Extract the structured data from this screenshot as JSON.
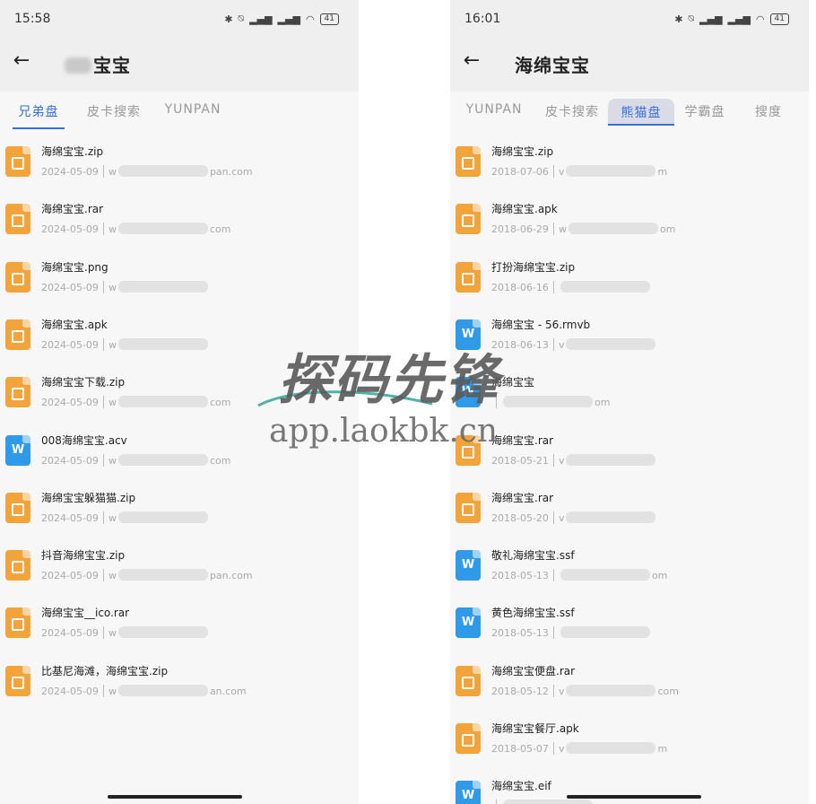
{
  "left": {
    "time": "15:58",
    "battery": "41",
    "title": "宝宝",
    "tabs": [
      "兄弟盘",
      "皮卡搜索",
      "YUNPAN"
    ],
    "active_tab": 0,
    "files": [
      {
        "name": "海绵宝宝.zip",
        "date": "2024-05-09",
        "src_prefix": "w",
        "src_suffix": "pan.com",
        "type": "zip"
      },
      {
        "name": "海绵宝宝.rar",
        "date": "2024-05-09",
        "src_prefix": "w",
        "src_suffix": "com",
        "type": "zip"
      },
      {
        "name": "海绵宝宝.png",
        "date": "2024-05-09",
        "src_prefix": "w",
        "src_suffix": "",
        "type": "zip"
      },
      {
        "name": "海绵宝宝.apk",
        "date": "2024-05-09",
        "src_prefix": "w",
        "src_suffix": "",
        "type": "zip"
      },
      {
        "name": "海绵宝宝下载.zip",
        "date": "2024-05-09",
        "src_prefix": "w",
        "src_suffix": "com",
        "type": "zip"
      },
      {
        "name": "008海绵宝宝.acv",
        "date": "2024-05-09",
        "src_prefix": "w",
        "src_suffix": "com",
        "type": "doc"
      },
      {
        "name": "海绵宝宝躲猫猫.zip",
        "date": "2024-05-09",
        "src_prefix": "w",
        "src_suffix": "",
        "type": "zip"
      },
      {
        "name": "抖音海绵宝宝.zip",
        "date": "2024-05-09",
        "src_prefix": "w",
        "src_suffix": "pan.com",
        "type": "zip"
      },
      {
        "name": "海绵宝宝__ico.rar",
        "date": "2024-05-09",
        "src_prefix": "w",
        "src_suffix": "",
        "type": "zip"
      },
      {
        "name": "比基尼海滩，海绵宝宝.zip",
        "date": "2024-05-09",
        "src_prefix": "w",
        "src_suffix": "an.com",
        "type": "zip"
      }
    ]
  },
  "right": {
    "time": "16:01",
    "battery": "41",
    "title": "海绵宝宝",
    "tabs": [
      "YUNPAN",
      "皮卡搜索",
      "熊猫盘",
      "学霸盘",
      "搜度"
    ],
    "active_tab": 2,
    "files": [
      {
        "name": "海绵宝宝.zip",
        "date": "2018-07-06",
        "src_prefix": "v",
        "src_suffix": "m",
        "type": "zip"
      },
      {
        "name": "海绵宝宝.apk",
        "date": "2018-06-29",
        "src_prefix": "w",
        "src_suffix": "om",
        "type": "zip"
      },
      {
        "name": "打扮海绵宝宝.zip",
        "date": "2018-06-16",
        "src_prefix": "",
        "src_suffix": "",
        "type": "zip"
      },
      {
        "name": "海绵宝宝 - 56.rmvb",
        "date": "2018-06-13",
        "src_prefix": "v",
        "src_suffix": "",
        "type": "doc"
      },
      {
        "name": "海绵宝宝",
        "date": "",
        "src_prefix": "",
        "src_suffix": "om",
        "type": "doc"
      },
      {
        "name": "海绵宝宝.rar",
        "date": "2018-05-21",
        "src_prefix": "v",
        "src_suffix": "",
        "type": "zip"
      },
      {
        "name": "海绵宝宝.rar",
        "date": "2018-05-20",
        "src_prefix": "v",
        "src_suffix": "",
        "type": "zip"
      },
      {
        "name": "敬礼海绵宝宝.ssf",
        "date": "2018-05-13",
        "src_prefix": "",
        "src_suffix": "om",
        "type": "doc"
      },
      {
        "name": "黄色海绵宝宝.ssf",
        "date": "2018-05-13",
        "src_prefix": "",
        "src_suffix": "",
        "type": "doc"
      },
      {
        "name": "海绵宝宝便盘.rar",
        "date": "2018-05-12",
        "src_prefix": "v",
        "src_suffix": "com",
        "type": "zip"
      },
      {
        "name": "海绵宝宝餐厅.apk",
        "date": "2018-05-07",
        "src_prefix": "v",
        "src_suffix": "m",
        "type": "zip"
      },
      {
        "name": "海绵宝宝.eif",
        "date": "",
        "src_prefix": "",
        "src_suffix": "",
        "type": "doc"
      }
    ]
  },
  "watermark": {
    "brand": "探码先锋",
    "url": "app.laokbk.cn"
  },
  "colors": {
    "accent": "#3a6fd9",
    "zip_icon": "#f2a33a",
    "doc_icon": "#2f9ae8"
  }
}
